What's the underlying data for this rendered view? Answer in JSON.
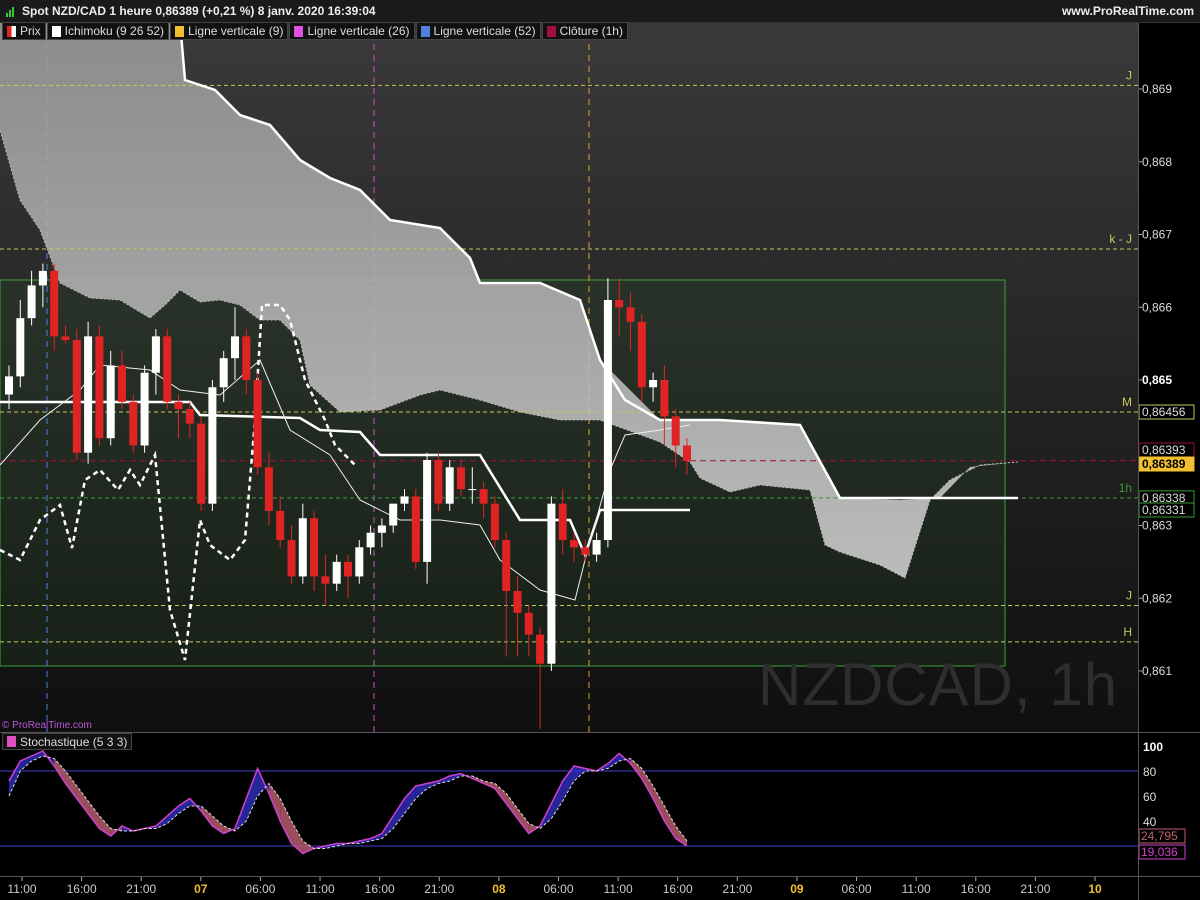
{
  "header": {
    "title": "Spot NZD/CAD 1 heure 0,86389 (+0,21 %) 8 janv. 2020 16:39:04",
    "brand": "www.ProRealTime.com"
  },
  "legend": [
    {
      "label": "Prix",
      "color": "#e02424"
    },
    {
      "label": "Ichimoku (9 26 52)",
      "color": "#ffffff"
    },
    {
      "label": "Ligne verticale (9)",
      "color": "#f0c030"
    },
    {
      "label": "Ligne verticale (26)",
      "color": "#e050e0"
    },
    {
      "label": "Ligne verticale (52)",
      "color": "#5080e0"
    },
    {
      "label": "Clôture (1h)",
      "color": "#a0103a"
    }
  ],
  "watermark": "NZDCAD, 1h",
  "credit": "© ProRealTime.com",
  "stoch_label": "Stochastique (5 3 3)",
  "chart_data": [
    {
      "type": "candlestick",
      "ylim": [
        0.8604,
        0.87
      ],
      "y_ticks": [
        "0,869",
        "0,868",
        "0,867",
        "0,866",
        "0,865",
        "0,863",
        "0,862",
        "0,861"
      ],
      "x_ticks": [
        "11:00",
        "16:00",
        "21:00",
        "07",
        "06:00",
        "11:00",
        "16:00",
        "21:00",
        "08",
        "06:00",
        "11:00",
        "16:00",
        "21:00",
        "09",
        "06:00",
        "11:00",
        "16:00",
        "21:00",
        "10"
      ],
      "candles": [
        [
          0.8648,
          0.86505,
          0.8646,
          0.8652
        ],
        [
          0.86505,
          0.86585,
          0.8649,
          0.8661
        ],
        [
          0.86585,
          0.8663,
          0.86575,
          0.8665
        ],
        [
          0.8663,
          0.8665,
          0.866,
          0.8666
        ],
        [
          0.8665,
          0.8656,
          0.8654,
          0.8666
        ],
        [
          0.8656,
          0.86555,
          0.8655,
          0.86575
        ],
        [
          0.86555,
          0.864,
          0.8639,
          0.8657
        ],
        [
          0.864,
          0.8656,
          0.86385,
          0.8658
        ],
        [
          0.8656,
          0.8642,
          0.8641,
          0.86575
        ],
        [
          0.8642,
          0.8652,
          0.8641,
          0.8654
        ],
        [
          0.8652,
          0.8647,
          0.8646,
          0.8654
        ],
        [
          0.8647,
          0.8641,
          0.864,
          0.8648
        ],
        [
          0.8641,
          0.8651,
          0.864,
          0.8652
        ],
        [
          0.8651,
          0.8656,
          0.8648,
          0.8657
        ],
        [
          0.8656,
          0.8647,
          0.8646,
          0.8657
        ],
        [
          0.8647,
          0.8646,
          0.8642,
          0.8648
        ],
        [
          0.8646,
          0.8644,
          0.8642,
          0.8647
        ],
        [
          0.8644,
          0.8633,
          0.8632,
          0.8645
        ],
        [
          0.8633,
          0.8649,
          0.8632,
          0.865
        ],
        [
          0.8649,
          0.8653,
          0.8647,
          0.8654
        ],
        [
          0.8653,
          0.8656,
          0.865,
          0.866
        ],
        [
          0.8656,
          0.865,
          0.8648,
          0.8657
        ],
        [
          0.865,
          0.8638,
          0.8637,
          0.8651
        ],
        [
          0.8638,
          0.8632,
          0.863,
          0.864
        ],
        [
          0.8632,
          0.8628,
          0.8627,
          0.8634
        ],
        [
          0.8628,
          0.8623,
          0.8622,
          0.863
        ],
        [
          0.8623,
          0.8631,
          0.8622,
          0.8633
        ],
        [
          0.8631,
          0.8623,
          0.8621,
          0.8632
        ],
        [
          0.8623,
          0.8622,
          0.8619,
          0.8626
        ],
        [
          0.8622,
          0.8625,
          0.8621,
          0.8626
        ],
        [
          0.8625,
          0.8623,
          0.862,
          0.8626
        ],
        [
          0.8623,
          0.8627,
          0.8622,
          0.8628
        ],
        [
          0.8627,
          0.8629,
          0.8626,
          0.863
        ],
        [
          0.8629,
          0.863,
          0.8627,
          0.8631
        ],
        [
          0.863,
          0.8633,
          0.8629,
          0.8633
        ],
        [
          0.8633,
          0.8634,
          0.8632,
          0.8635
        ],
        [
          0.8634,
          0.8625,
          0.8624,
          0.8635
        ],
        [
          0.8625,
          0.8639,
          0.8622,
          0.864
        ],
        [
          0.8639,
          0.8633,
          0.8632,
          0.864
        ],
        [
          0.8633,
          0.8638,
          0.8632,
          0.8639
        ],
        [
          0.8638,
          0.8635,
          0.8634,
          0.8639
        ],
        [
          0.8635,
          0.8635,
          0.8633,
          0.8638
        ],
        [
          0.8635,
          0.8633,
          0.8631,
          0.8636
        ],
        [
          0.8633,
          0.8628,
          0.8627,
          0.8634
        ],
        [
          0.8628,
          0.8621,
          0.8612,
          0.8629
        ],
        [
          0.8621,
          0.8618,
          0.8612,
          0.8623
        ],
        [
          0.8618,
          0.8615,
          0.8612,
          0.8619
        ],
        [
          0.8615,
          0.8611,
          0.8602,
          0.8616
        ],
        [
          0.8611,
          0.8633,
          0.861,
          0.8634
        ],
        [
          0.8633,
          0.8628,
          0.8626,
          0.8635
        ],
        [
          0.8628,
          0.8627,
          0.8625,
          0.8629
        ],
        [
          0.8627,
          0.8626,
          0.8625,
          0.8628
        ],
        [
          0.8626,
          0.8628,
          0.8625,
          0.8629
        ],
        [
          0.8628,
          0.8661,
          0.8627,
          0.8664
        ],
        [
          0.8661,
          0.866,
          0.8656,
          0.8664
        ],
        [
          0.866,
          0.8658,
          0.8654,
          0.8662
        ],
        [
          0.8658,
          0.8649,
          0.8647,
          0.8659
        ],
        [
          0.8649,
          0.865,
          0.8647,
          0.8651
        ],
        [
          0.865,
          0.8645,
          0.8641,
          0.8652
        ],
        [
          0.8645,
          0.8641,
          0.8638,
          0.8646
        ],
        [
          0.8641,
          0.86389,
          0.8637,
          0.8642
        ]
      ],
      "horizontal_lines": [
        {
          "label": "J",
          "value": 0.86905,
          "color": "#c8c85a"
        },
        {
          "label": "k - J",
          "value": 0.8668,
          "color": "#c8c85a"
        },
        {
          "label": "M",
          "value": 0.86456,
          "color": "#c8c85a",
          "tag": "0,86456"
        },
        {
          "label": "1h",
          "value": 0.86338,
          "color": "#3a9a3a",
          "tag": "0,86338"
        },
        {
          "label": "J",
          "value": 0.8619,
          "color": "#c8c85a"
        },
        {
          "label": "H",
          "value": 0.8614,
          "color": "#c8c85a"
        }
      ],
      "price_tags": [
        "0,86393",
        "0,86389",
        "0,86331"
      ],
      "current_price_tag": "0,86389"
    },
    {
      "type": "line",
      "name": "Stochastique (5 3 3)",
      "ylim": [
        0,
        100
      ],
      "y_ticks": [
        "100",
        "80",
        "60",
        "40"
      ],
      "levels": [
        80,
        20
      ],
      "k": [
        72,
        88,
        92,
        96,
        84,
        70,
        58,
        46,
        34,
        28,
        36,
        32,
        34,
        36,
        44,
        52,
        58,
        48,
        36,
        30,
        34,
        58,
        82,
        62,
        40,
        22,
        14,
        18,
        20,
        22,
        22,
        24,
        26,
        30,
        44,
        58,
        68,
        70,
        72,
        76,
        78,
        74,
        70,
        66,
        54,
        42,
        30,
        36,
        54,
        72,
        84,
        82,
        80,
        86,
        94,
        86,
        74,
        58,
        40,
        26,
        20
      ],
      "d": [
        60,
        80,
        88,
        92,
        90,
        80,
        68,
        56,
        44,
        34,
        32,
        32,
        34,
        34,
        38,
        46,
        52,
        52,
        44,
        36,
        32,
        40,
        60,
        70,
        58,
        40,
        24,
        18,
        18,
        20,
        22,
        22,
        24,
        26,
        34,
        46,
        58,
        66,
        70,
        72,
        76,
        76,
        72,
        70,
        62,
        50,
        38,
        34,
        42,
        56,
        72,
        80,
        80,
        82,
        88,
        90,
        82,
        68,
        52,
        36,
        24
      ],
      "tags": [
        "24,795",
        "19,036"
      ]
    }
  ]
}
